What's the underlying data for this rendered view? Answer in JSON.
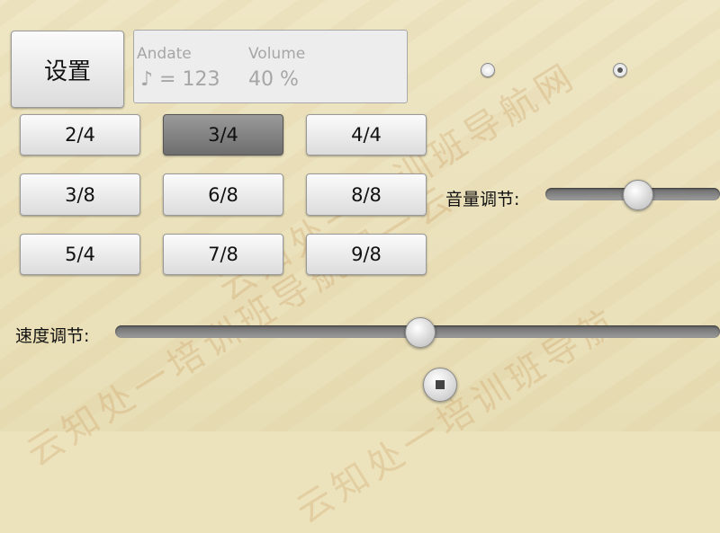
{
  "settings": {
    "label": "设置"
  },
  "display": {
    "tempo_label": "Andate",
    "tempo_value": "♪ = 123",
    "volume_label": "Volume",
    "volume_value": "40 %"
  },
  "meters": {
    "row1": [
      "2/4",
      "3/4",
      "4/4"
    ],
    "row2": [
      "3/8",
      "6/8",
      "8/8"
    ],
    "row3": [
      "5/4",
      "7/8",
      "9/8"
    ],
    "selected": "3/4"
  },
  "radios": {
    "selected_index": 1
  },
  "volume_slider": {
    "label": "音量调节:",
    "value_percent": 40
  },
  "tempo_slider": {
    "label": "速度调节:",
    "value_fraction": 0.5
  },
  "icons": {
    "stop": "stop-icon"
  }
}
